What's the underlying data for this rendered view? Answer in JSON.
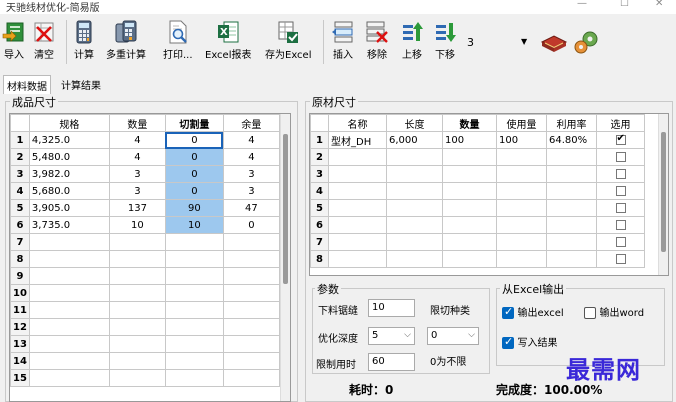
{
  "window": {
    "title": "天驰线材优化-简易版"
  },
  "toolbar": {
    "import": "导入",
    "clear": "清空",
    "calc": "计算",
    "multi_calc": "多重计算",
    "print": "打印...",
    "excel_report": "Excel报表",
    "save_excel": "存为Excel",
    "insert": "插入",
    "remove": "移除",
    "move_up": "上移",
    "move_down": "下移",
    "combo_value": "3"
  },
  "tabs": [
    {
      "label": "材料数据",
      "active": true
    },
    {
      "label": "计算结果",
      "active": false
    }
  ],
  "product": {
    "group_label": "成品尺寸",
    "headers": [
      "规格",
      "数量",
      "切割量",
      "余量"
    ],
    "rows": [
      {
        "n": "1",
        "spec": "4,325.0",
        "qty": "4",
        "cut": "0",
        "rem": "4"
      },
      {
        "n": "2",
        "spec": "5,480.0",
        "qty": "4",
        "cut": "0",
        "rem": "4"
      },
      {
        "n": "3",
        "spec": "3,982.0",
        "qty": "3",
        "cut": "0",
        "rem": "3"
      },
      {
        "n": "4",
        "spec": "5,680.0",
        "qty": "3",
        "cut": "0",
        "rem": "3"
      },
      {
        "n": "5",
        "spec": "3,905.0",
        "qty": "137",
        "cut": "90",
        "rem": "47"
      },
      {
        "n": "6",
        "spec": "3,735.0",
        "qty": "10",
        "cut": "10",
        "rem": "0"
      },
      {
        "n": "7",
        "spec": "",
        "qty": "",
        "cut": "",
        "rem": ""
      },
      {
        "n": "8",
        "spec": "",
        "qty": "",
        "cut": "",
        "rem": ""
      },
      {
        "n": "9",
        "spec": "",
        "qty": "",
        "cut": "",
        "rem": ""
      },
      {
        "n": "10",
        "spec": "",
        "qty": "",
        "cut": "",
        "rem": ""
      },
      {
        "n": "11",
        "spec": "",
        "qty": "",
        "cut": "",
        "rem": ""
      },
      {
        "n": "12",
        "spec": "",
        "qty": "",
        "cut": "",
        "rem": ""
      },
      {
        "n": "13",
        "spec": "",
        "qty": "",
        "cut": "",
        "rem": ""
      },
      {
        "n": "14",
        "spec": "",
        "qty": "",
        "cut": "",
        "rem": ""
      },
      {
        "n": "15",
        "spec": "",
        "qty": "",
        "cut": "",
        "rem": ""
      }
    ]
  },
  "raw": {
    "group_label": "原材尺寸",
    "headers": [
      "名称",
      "长度",
      "数量",
      "使用量",
      "利用率",
      "选用"
    ],
    "rows": [
      {
        "n": "1",
        "name": "型材_DH",
        "len": "6,000",
        "qty": "100",
        "used": "100",
        "rate": "64.80%",
        "sel": true
      },
      {
        "n": "2",
        "name": "",
        "len": "",
        "qty": "",
        "used": "",
        "rate": "",
        "sel": false
      },
      {
        "n": "3",
        "name": "",
        "len": "",
        "qty": "",
        "used": "",
        "rate": "",
        "sel": false
      },
      {
        "n": "4",
        "name": "",
        "len": "",
        "qty": "",
        "used": "",
        "rate": "",
        "sel": false
      },
      {
        "n": "5",
        "name": "",
        "len": "",
        "qty": "",
        "used": "",
        "rate": "",
        "sel": false
      },
      {
        "n": "6",
        "name": "",
        "len": "",
        "qty": "",
        "used": "",
        "rate": "",
        "sel": false
      },
      {
        "n": "7",
        "name": "",
        "len": "",
        "qty": "",
        "used": "",
        "rate": "",
        "sel": false
      },
      {
        "n": "8",
        "name": "",
        "len": "",
        "qty": "",
        "used": "",
        "rate": "",
        "sel": false
      }
    ]
  },
  "params": {
    "group_label": "参数",
    "kerf_label": "下料锯缝",
    "kerf_value": "10",
    "cut_type_label": "限切种类",
    "depth_label": "优化深度",
    "depth_value": "5",
    "cut_type_value": "0",
    "time_limit_label": "限制用时",
    "time_limit_value": "60",
    "zero_note": "0为不限"
  },
  "excel_out": {
    "group_label": "从Excel输出",
    "out_excel": "输出excel",
    "out_word": "输出word",
    "write_result": "写入结果",
    "out_excel_checked": true,
    "out_word_checked": false,
    "write_result_checked": true
  },
  "status": {
    "time_label": "耗时：",
    "time_value": "0",
    "done_label": "完成度：",
    "done_value": "100.00%"
  },
  "watermark": "最需网"
}
